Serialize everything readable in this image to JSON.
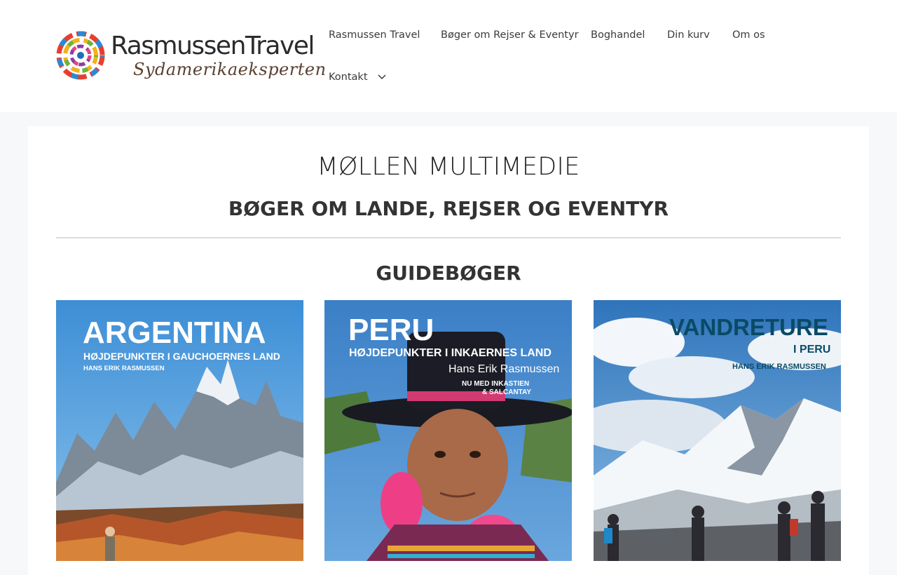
{
  "header": {
    "logo": {
      "title": "RasmussenTravel",
      "subtitle": "Sydamerikaeksperten"
    },
    "nav": [
      {
        "label": "Rasmussen Travel"
      },
      {
        "label": "Bøger om Rejser & Eventyr"
      },
      {
        "label": "Boghandel"
      },
      {
        "label": "Din kurv"
      },
      {
        "label": "Om os"
      },
      {
        "label": "Kontakt",
        "icon": "chevron-down-icon"
      }
    ]
  },
  "main": {
    "title": "MØLLEN MULTIMEDIE",
    "subtitle": "BØGER OM LANDE, REJSER OG EVENTYR",
    "section_title": "GUIDEBØGER",
    "books": [
      {
        "title": "ARGENTINA",
        "subtitle": "HØJDEPUNKTER I GAUCHOERNES LAND",
        "author": "HANS ERIK RASMUSSEN",
        "colors": {
          "text": "#ffffff",
          "sky": "#5aa0d8"
        }
      },
      {
        "title": "PERU",
        "subtitle": "HØJDEPUNKTER I INKAERNES LAND",
        "author": "Hans Erik Rasmussen",
        "note_line1": "NU MED INKASTIEN",
        "note_line2": "& SALCANTAY",
        "colors": {
          "text": "#ffffff",
          "sky": "#4a8ed0"
        }
      },
      {
        "title": "VANDRETURE",
        "subtitle": "I PERU",
        "author": "HANS ERIK RASMUSSEN",
        "colors": {
          "text": "#0a4a66",
          "sky": "#4a88c8"
        }
      }
    ]
  }
}
